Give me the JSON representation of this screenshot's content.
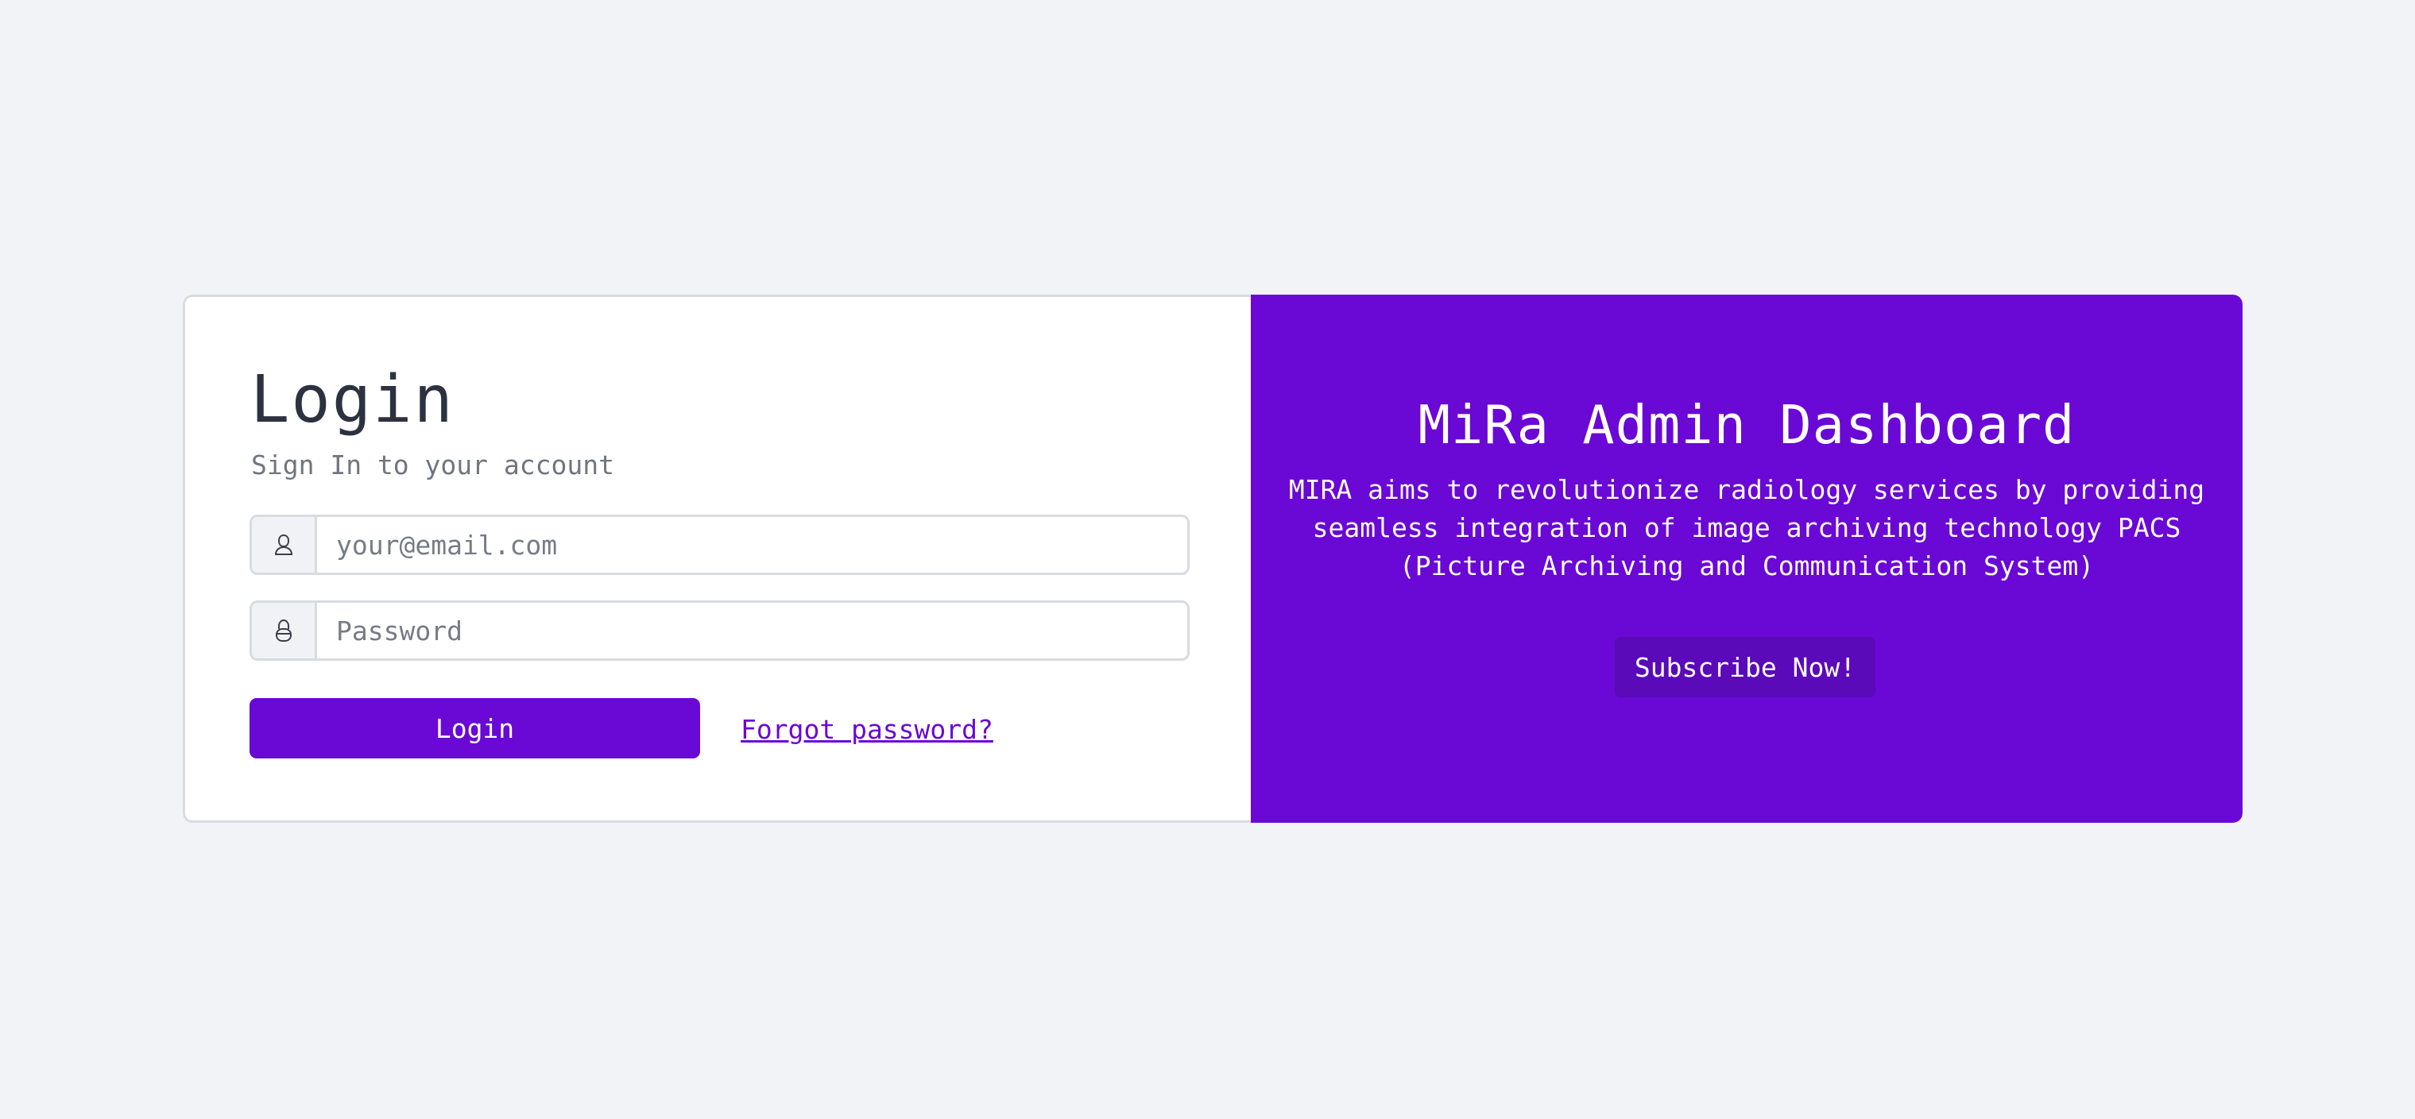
{
  "login": {
    "title": "Login",
    "subtitle": "Sign In to your account",
    "email_placeholder": "your@email.com",
    "password_placeholder": "Password",
    "login_button": "Login",
    "forgot_password": "Forgot password?",
    "icons": {
      "email": "user-icon",
      "password": "lock-icon"
    }
  },
  "promo": {
    "title": "MiRa Admin Dashboard",
    "description": "MIRA aims to revolutionize radiology services by providing seamless integration of image archiving technology PACS (Picture Archiving and Communication System)",
    "subscribe_button": "Subscribe Now!"
  },
  "colors": {
    "brand": "#6a08d6",
    "background": "#f2f3f7",
    "button_dark": "#5a0ab8"
  }
}
